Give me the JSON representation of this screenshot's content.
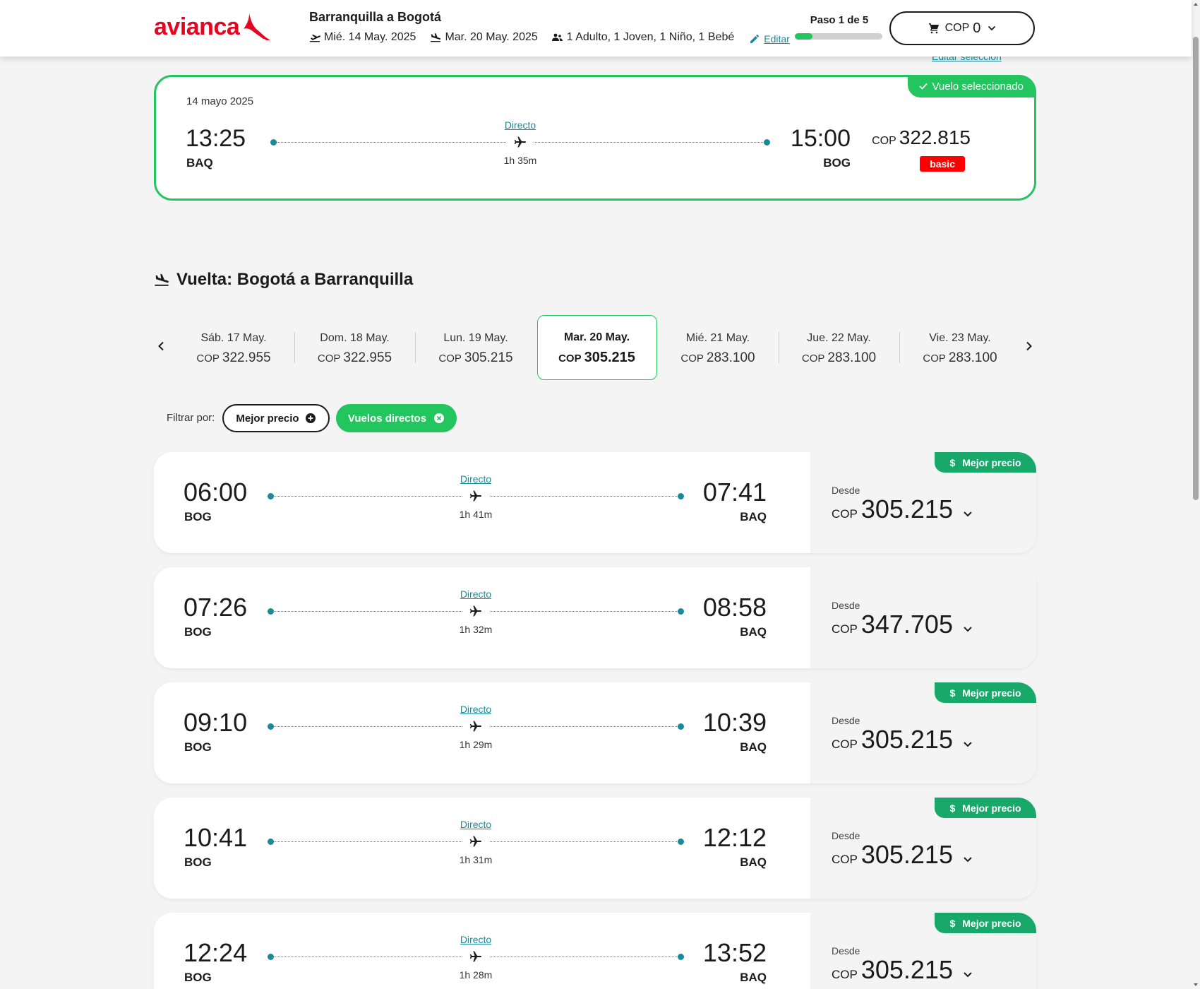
{
  "header": {
    "logo_text": "avianca",
    "route_title": "Barranquilla a Bogotá",
    "outbound_date": "Mié. 14 May. 2025",
    "return_date": "Mar. 20 May. 2025",
    "passengers": "1 Adulto, 1 Joven, 1 Niño, 1 Bebé",
    "edit_label": "Editar",
    "step_label": "Paso 1 de 5",
    "step_progress": 0.2,
    "cart_currency": "COP",
    "cart_amount": "0"
  },
  "edit_selection_label": "Editar selección",
  "selected_flight": {
    "badge": "Vuelo seleccionado",
    "date": "14 mayo 2025",
    "depart_time": "13:25",
    "depart_code": "BAQ",
    "arrive_time": "15:00",
    "arrive_code": "BOG",
    "stops": "Directo",
    "duration": "1h 35m",
    "currency": "COP",
    "price": "322.815",
    "fare_tag": "basic"
  },
  "return_section": {
    "title": "Vuelta: Bogotá a Barranquilla"
  },
  "dates": [
    {
      "day": "Sáb. 17 May.",
      "currency": "COP",
      "price": "322.955"
    },
    {
      "day": "Dom. 18 May.",
      "currency": "COP",
      "price": "322.955"
    },
    {
      "day": "Lun. 19 May.",
      "currency": "COP",
      "price": "305.215"
    },
    {
      "day": "Mar. 20 May.",
      "currency": "COP",
      "price": "305.215"
    },
    {
      "day": "Mié. 21 May.",
      "currency": "COP",
      "price": "283.100"
    },
    {
      "day": "Jue. 22 May.",
      "currency": "COP",
      "price": "283.100"
    },
    {
      "day": "Vie. 23 May.",
      "currency": "COP",
      "price": "283.100"
    }
  ],
  "filters": {
    "label": "Filtrar por:",
    "best_price": "Mejor precio",
    "direct": "Vuelos directos"
  },
  "flights": [
    {
      "depart_time": "06:00",
      "depart_code": "BOG",
      "arrive_time": "07:41",
      "arrive_code": "BAQ",
      "stops": "Directo",
      "duration": "1h 41m",
      "from_label": "Desde",
      "currency": "COP",
      "price": "305.215",
      "best_label": "Mejor precio"
    },
    {
      "depart_time": "07:26",
      "depart_code": "BOG",
      "arrive_time": "08:58",
      "arrive_code": "BAQ",
      "stops": "Directo",
      "duration": "1h 32m",
      "from_label": "Desde",
      "currency": "COP",
      "price": "347.705",
      "best_label": ""
    },
    {
      "depart_time": "09:10",
      "depart_code": "BOG",
      "arrive_time": "10:39",
      "arrive_code": "BAQ",
      "stops": "Directo",
      "duration": "1h 29m",
      "from_label": "Desde",
      "currency": "COP",
      "price": "305.215",
      "best_label": "Mejor precio"
    },
    {
      "depart_time": "10:41",
      "depart_code": "BOG",
      "arrive_time": "12:12",
      "arrive_code": "BAQ",
      "stops": "Directo",
      "duration": "1h 31m",
      "from_label": "Desde",
      "currency": "COP",
      "price": "305.215",
      "best_label": "Mejor precio"
    },
    {
      "depart_time": "12:24",
      "depart_code": "BOG",
      "arrive_time": "13:52",
      "arrive_code": "BAQ",
      "stops": "Directo",
      "duration": "1h 28m",
      "from_label": "Desde",
      "currency": "COP",
      "price": "305.215",
      "best_label": "Mejor precio"
    }
  ],
  "colors": {
    "brand_red": "#e40521",
    "accent_green": "#22c55e",
    "best_price_green": "#18a86a",
    "link_teal": "#1a8a9a"
  }
}
